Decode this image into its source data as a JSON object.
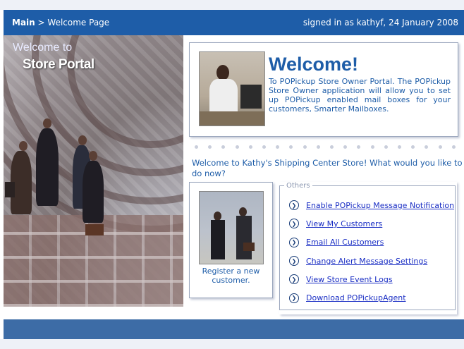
{
  "header": {
    "breadcrumb_main": "Main",
    "breadcrumb_separator": ">",
    "breadcrumb_current": "Welcome Page",
    "signed_in": "signed in as kathyf, 24 January 2008"
  },
  "hero": {
    "line1": "Welcome  to",
    "line2": "Store Portal"
  },
  "welcome": {
    "title": "Welcome!",
    "text": "To POPickup Store Owner Portal. The POPickup Store Owner application will allow you to set up POPickup enabled mail boxes for your customers, Smarter Mailboxes."
  },
  "store_question": "Welcome to Kathy's Shipping Center Store! What would you like to do now?",
  "register": {
    "label": "Register a new customer."
  },
  "others": {
    "legend": "Others",
    "links": [
      {
        "label": "Enable POPickup Message Notification"
      },
      {
        "label": "View My Customers"
      },
      {
        "label": "Email All Customers"
      },
      {
        "label": "Change Alert Message Settings"
      },
      {
        "label": "View Store Event Logs"
      },
      {
        "label": "Download POPickupAgent"
      }
    ],
    "link_icon": "circle-arrow-right-icon"
  },
  "colors": {
    "header_bg": "#1e5da8",
    "accent_text": "#1e5da8",
    "link": "#1a2ec4",
    "footer_bg": "#3d6ca6"
  }
}
